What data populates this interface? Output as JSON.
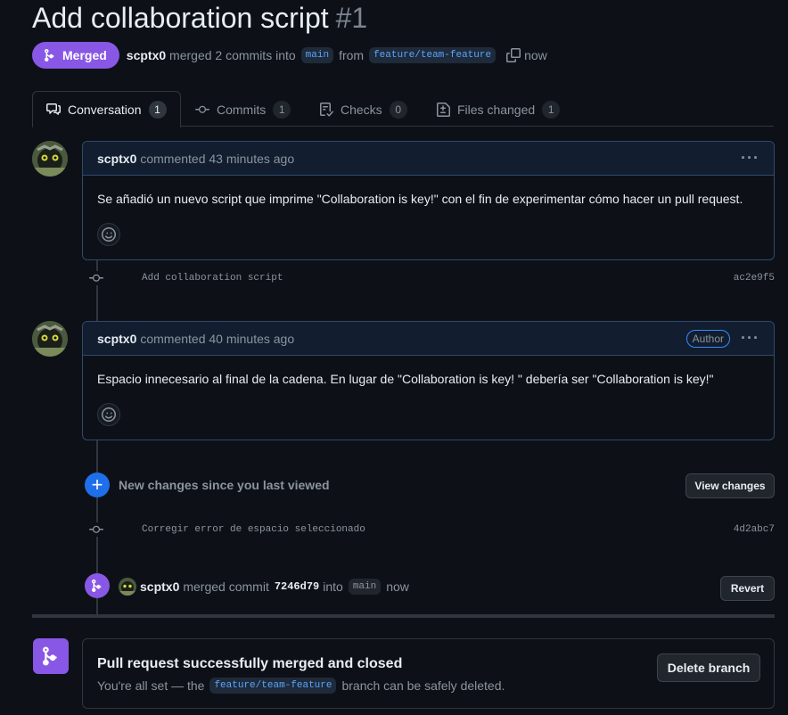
{
  "pr": {
    "title": "Add collaboration script",
    "number": "#1",
    "state": "Merged",
    "author": "scptx0",
    "merged_text": "merged 2 commits into",
    "base_branch": "main",
    "from_text": "from",
    "head_branch": "feature/team-feature",
    "time": "now"
  },
  "tabs": [
    {
      "label": "Conversation",
      "count": "1",
      "icon": "comment-discussion-icon"
    },
    {
      "label": "Commits",
      "count": "1",
      "icon": "git-commit-icon"
    },
    {
      "label": "Checks",
      "count": "0",
      "icon": "checklist-icon"
    },
    {
      "label": "Files changed",
      "count": "1",
      "icon": "file-diff-icon"
    }
  ],
  "comments": [
    {
      "author": "scptx0",
      "meta": "commented 43 minutes ago",
      "body": "Se añadió un nuevo script que imprime \"Collaboration is key!\" con el fin de experimentar cómo hacer un pull request.",
      "badge": ""
    },
    {
      "author": "scptx0",
      "meta": "commented 40 minutes ago",
      "body": "Espacio innecesario al final de la cadena. En lugar de \"Collaboration is key! \" debería ser \"Collaboration is key!\"",
      "badge": "Author"
    }
  ],
  "commits": [
    {
      "message": "Add collaboration script",
      "sha": "ac2e9f5"
    },
    {
      "message": "Corregir error de espacio seleccionado",
      "sha": "4d2abc7"
    }
  ],
  "new_changes": {
    "text": "New changes since you last viewed",
    "button": "View changes"
  },
  "merge_event": {
    "author": "scptx0",
    "merged_text": "merged commit",
    "sha": "7246d79",
    "into_text": "into",
    "branch": "main",
    "time": "now",
    "button": "Revert"
  },
  "merge_box": {
    "title": "Pull request successfully merged and closed",
    "sub_before": "You're all set — the",
    "branch": "feature/team-feature",
    "sub_after": "branch can be safely deleted.",
    "button": "Delete branch"
  },
  "colors": {
    "merged_purple": "#8957e5",
    "accent_blue": "#1f6feb",
    "link_blue": "#58a6ff",
    "background": "#0d1117"
  }
}
